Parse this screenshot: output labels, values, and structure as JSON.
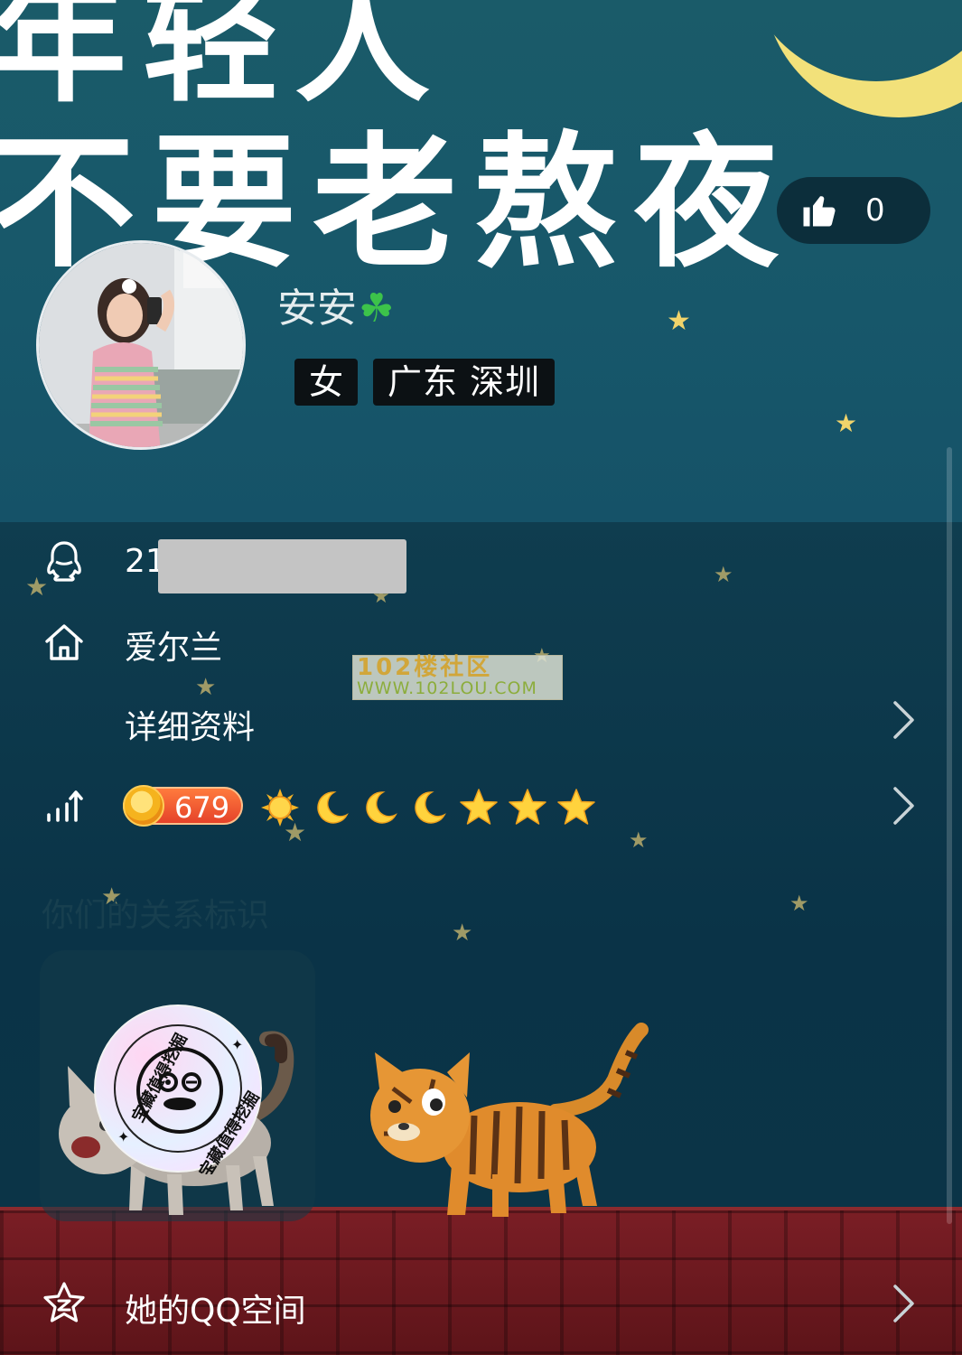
{
  "header": {
    "banner_line1": "年轻人",
    "banner_line2": "不要老熬夜",
    "like_count": "0",
    "nickname": "安安",
    "nickname_emoji": "☘",
    "gender_tag": "女",
    "region_tag": "广东 深圳"
  },
  "info": {
    "qq_prefix": "21",
    "hometown": "爱尔兰",
    "details_label": "详细资料",
    "level_value": "679"
  },
  "watermark": {
    "line1": "102楼社区",
    "line2": "WWW.102LOU.COM"
  },
  "relation": {
    "title": "你们的关系标识",
    "stamp_text": "宝藏值得挖掘"
  },
  "footer": {
    "space_label": "她的QQ空间"
  },
  "colors": {
    "banner_bg": "#1a5b69",
    "panel_bg": "#0f3d4f",
    "level_badge": "#e5422a",
    "star_gold": "#f7c52b",
    "moon": "#f2e17a"
  },
  "icons": [
    "thumbs-up-icon",
    "qq-penguin-icon",
    "home-icon",
    "level-trend-icon",
    "sun-icon",
    "moon-icon",
    "star-icon",
    "chevron-right-icon",
    "qzone-star-icon",
    "clover-emoji"
  ]
}
